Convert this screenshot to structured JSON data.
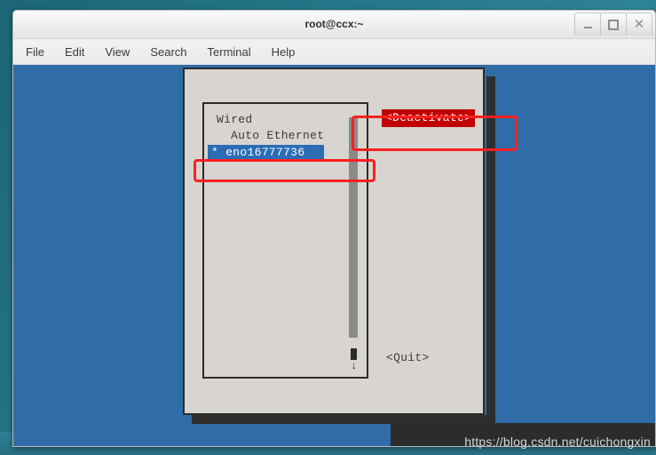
{
  "window": {
    "title": "root@ccx:~",
    "buttons": {
      "minimize": "minimize",
      "maximize": "maximize",
      "close": "✕"
    }
  },
  "menubar": {
    "items": [
      {
        "label": "File"
      },
      {
        "label": "Edit"
      },
      {
        "label": "View"
      },
      {
        "label": "Search"
      },
      {
        "label": "Terminal"
      },
      {
        "label": "Help"
      }
    ]
  },
  "dialog": {
    "list": {
      "rows": [
        {
          "label": "Wired",
          "selected": false
        },
        {
          "label": "Auto Ethernet",
          "selected": false
        },
        {
          "label": "* eno16777736",
          "selected": true
        }
      ]
    },
    "scrollbar": {
      "down_arrow": "↓"
    },
    "buttons": {
      "deactivate": "<Deactivate>",
      "quit": "<Quit>"
    }
  },
  "annotations": {
    "deactivate_highlight": "deactivate-button-highlight",
    "interface_highlight": "selected-interface-highlight"
  },
  "watermark": {
    "text": "https://blog.csdn.net/cuichongxin"
  },
  "colors": {
    "terminal_background": "#2f6ca8",
    "dialog_background": "#d8d5d0",
    "selection_blue": "#2a6db5",
    "deactivate_red": "#c00000",
    "annotation_red": "#fb2020"
  }
}
